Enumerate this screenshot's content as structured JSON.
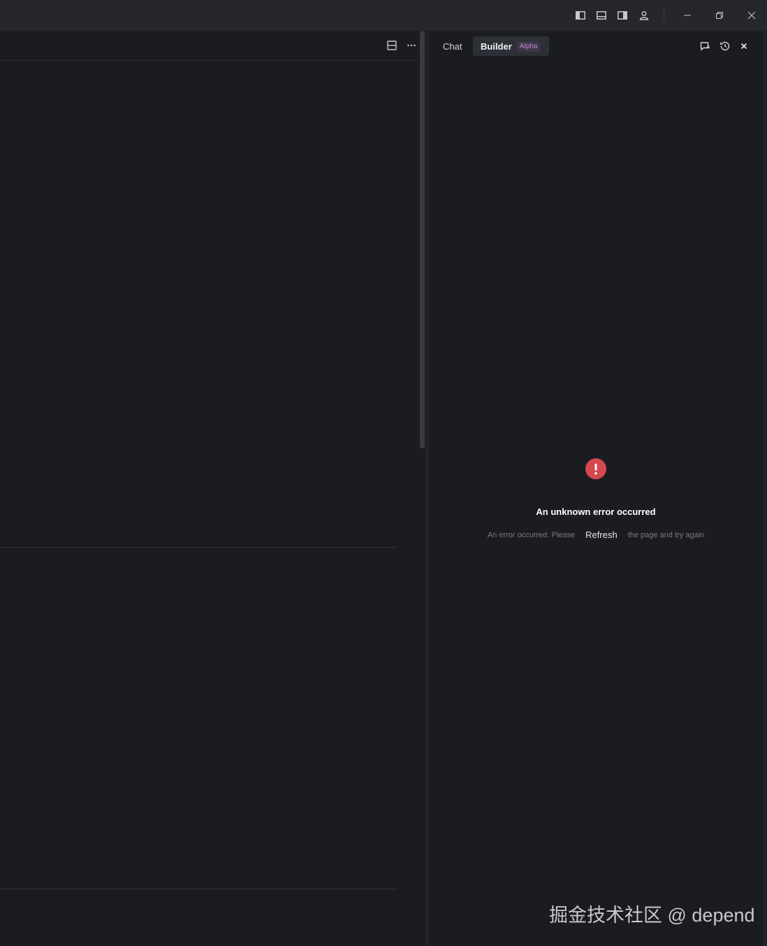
{
  "titlebar": {
    "icons": [
      "toggle-left-sidebar-icon",
      "toggle-bottom-panel-icon",
      "toggle-right-sidebar-icon",
      "account-icon",
      "minimize-icon",
      "restore-icon",
      "close-icon"
    ]
  },
  "editor": {
    "header_icons": [
      "split-editor-icon",
      "more-actions-icon"
    ]
  },
  "panel": {
    "tabs": [
      {
        "label": "Chat",
        "active": false
      },
      {
        "label": "Builder",
        "active": true,
        "badge": "Alpha"
      }
    ],
    "actions": [
      "new-chat-icon",
      "history-icon",
      "close-panel-icon"
    ],
    "error": {
      "title": "An unknown error occurred",
      "message_before": "An error occurred. Please",
      "refresh_label": "Refresh",
      "message_after": "the page and try again",
      "color": "#d5484f"
    }
  },
  "watermark": "掘金技术社区 @ depend"
}
